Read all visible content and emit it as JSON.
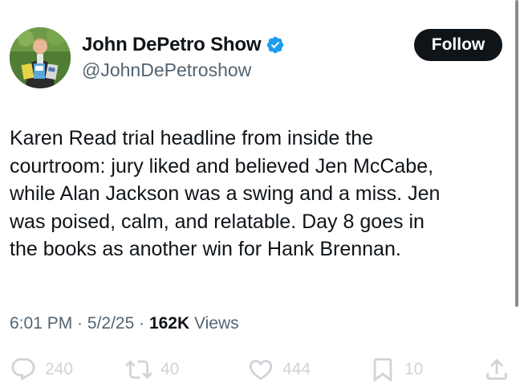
{
  "user": {
    "display_name": "John DePetro Show",
    "handle": "@JohnDePetroshow",
    "verified": true
  },
  "follow_label": "Follow",
  "tweet": {
    "text": "Karen Read trial headline from inside the\ncourtroom: jury liked and believed Jen McCabe,\nwhile Alan Jackson was a swing and a miss. Jen\nwas poised, calm, and relatable. Day 8 goes in\nthe books as another win for Hank Brennan."
  },
  "meta": {
    "time": "6:01 PM",
    "separator": " · ",
    "date": "5/2/25",
    "views_count": "162K",
    "views_label": " Views"
  },
  "actions": {
    "replies": "240",
    "reposts": "40",
    "likes": "444",
    "bookmarks": "10"
  },
  "colors": {
    "text": "#0f1419",
    "secondary": "#536471",
    "verified": "#1d9bf0",
    "action_faded": "#cfd4d8"
  },
  "icons": [
    "verified-badge-icon",
    "reply-icon",
    "repost-icon",
    "like-icon",
    "bookmark-icon",
    "share-icon"
  ]
}
